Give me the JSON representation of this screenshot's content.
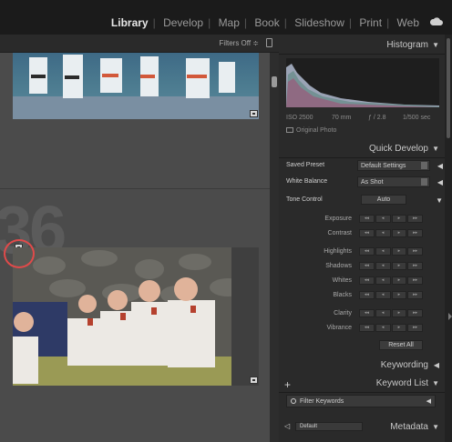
{
  "modules": [
    "Library",
    "Develop",
    "Map",
    "Book",
    "Slideshow",
    "Print",
    "Web"
  ],
  "active_module": "Library",
  "filterbar": {
    "label": "Filters Off ≑"
  },
  "grid": {
    "cell2_number": "36"
  },
  "histogram": {
    "title": "Histogram",
    "iso": "ISO 2500",
    "focal": "70 mm",
    "aperture": "ƒ / 2.8",
    "shutter": "1/500 sec",
    "original_label": "Original Photo"
  },
  "quick_develop": {
    "title": "Quick Develop",
    "saved_preset_label": "Saved Preset",
    "saved_preset_value": "Default Settings",
    "white_balance_label": "White Balance",
    "white_balance_value": "As Shot",
    "tone_control_label": "Tone Control",
    "tone_control_button": "Auto",
    "adjustments": [
      {
        "label": "Exposure"
      },
      {
        "label": "Contrast"
      },
      {
        "label": "Highlights"
      },
      {
        "label": "Shadows"
      },
      {
        "label": "Whites"
      },
      {
        "label": "Blacks"
      },
      {
        "label": "Clarity"
      },
      {
        "label": "Vibrance"
      }
    ],
    "reset_label": "Reset All"
  },
  "keywording": {
    "title": "Keywording"
  },
  "keyword_list": {
    "title": "Keyword List",
    "filter_placeholder": "Filter Keywords"
  },
  "metadata": {
    "title": "Metadata",
    "preset": "Default"
  }
}
